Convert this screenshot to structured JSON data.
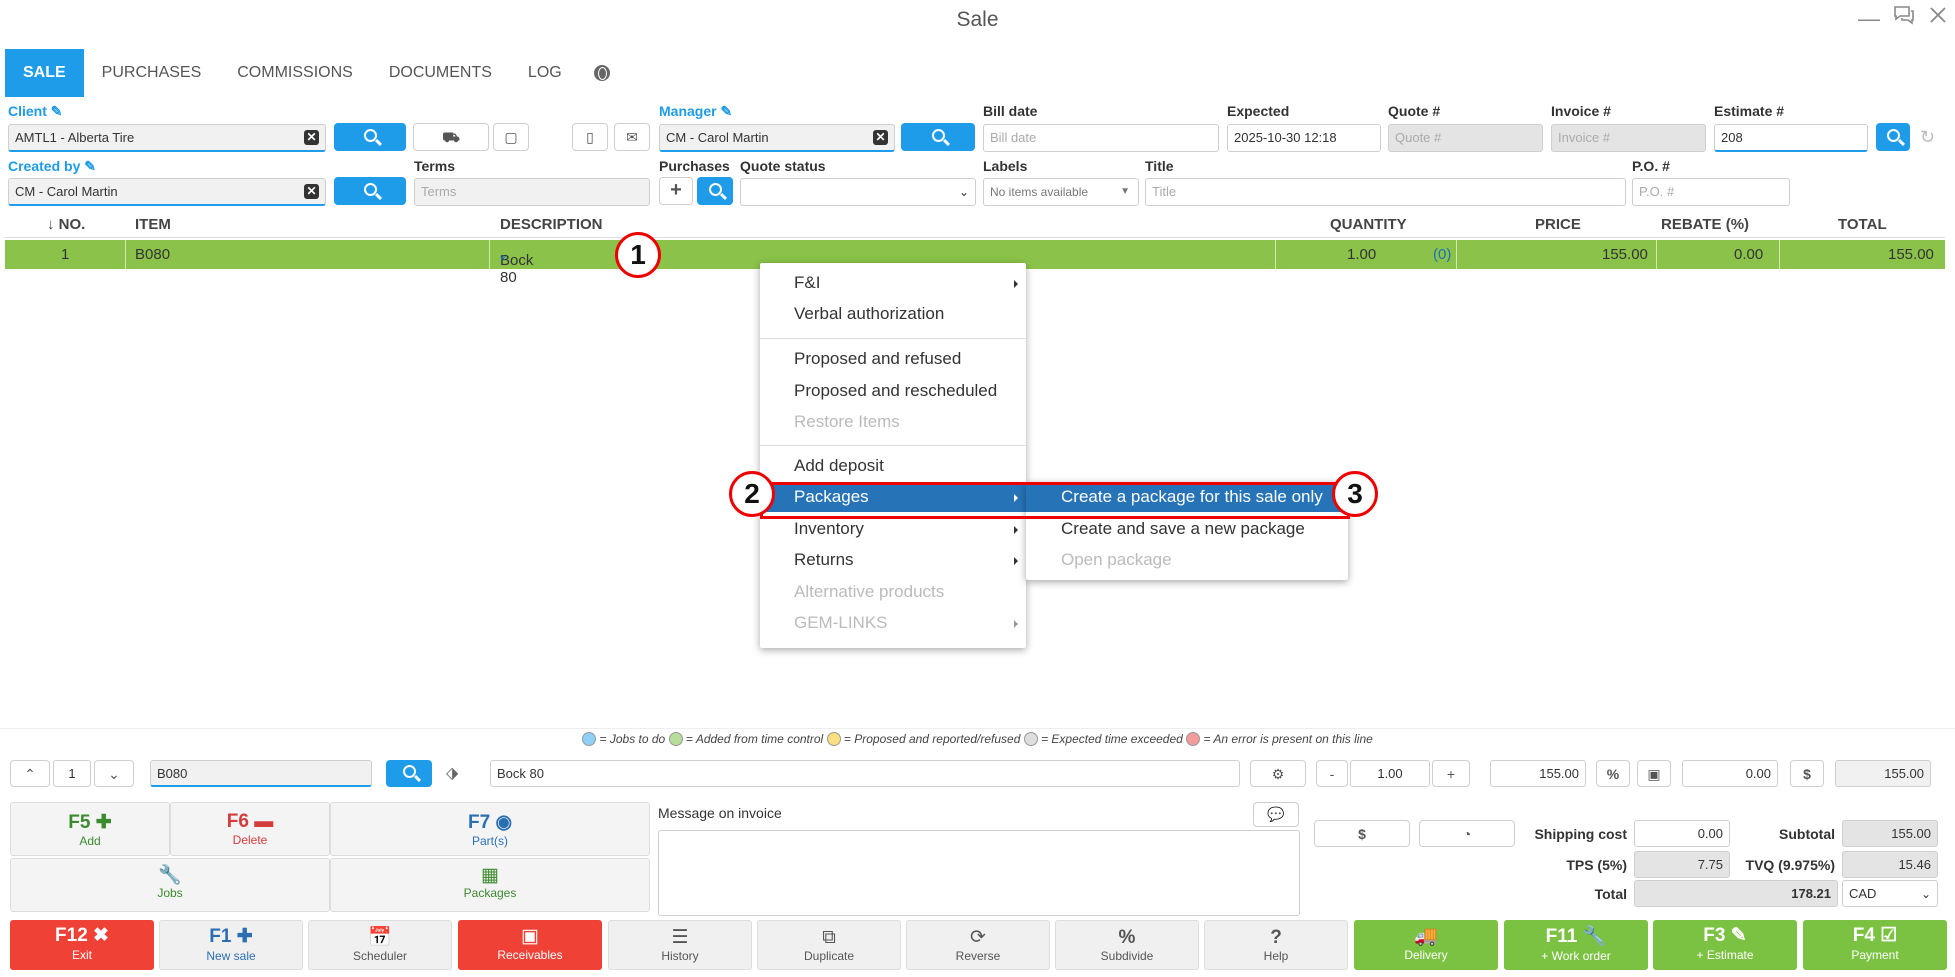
{
  "window": {
    "title": "Sale"
  },
  "tabs": [
    {
      "label": "SALE"
    },
    {
      "label": "PURCHASES"
    },
    {
      "label": "COMMISSIONS"
    },
    {
      "label": "DOCUMENTS"
    },
    {
      "label": "LOG"
    }
  ],
  "form": {
    "client_label": "Client",
    "client_value": "AMTL1 - Alberta Tire",
    "manager_label": "Manager",
    "manager_value": "CM - Carol Martin",
    "bill_date_label": "Bill date",
    "bill_date_placeholder": "Bill date",
    "expected_label": "Expected",
    "expected_value": "2025-10-30 12:18",
    "quote_label": "Quote #",
    "quote_placeholder": "Quote #",
    "invoice_label": "Invoice #",
    "invoice_placeholder": "Invoice #",
    "estimate_label": "Estimate #",
    "estimate_value": "208",
    "created_by_label": "Created by",
    "created_by_value": "CM - Carol Martin",
    "terms_label": "Terms",
    "terms_placeholder": "Terms",
    "purchases_label": "Purchases",
    "quote_status_label": "Quote status",
    "labels_label": "Labels",
    "labels_value": "No items available",
    "title_label": "Title",
    "title_placeholder": "Title",
    "po_label": "P.O. #",
    "po_placeholder": "P.O. #"
  },
  "grid": {
    "headers": [
      "↓ NO.",
      "ITEM",
      "DESCRIPTION",
      "QUANTITY",
      "PRICE",
      "REBATE (%)",
      "TOTAL"
    ],
    "rows": [
      {
        "no": "1",
        "item": "B080",
        "description": "Bock 80",
        "star": "*",
        "quantity": "1.00",
        "reserved": "(0)",
        "price": "155.00",
        "rebate": "0.00",
        "total": "155.00"
      }
    ]
  },
  "callouts": [
    "1",
    "2",
    "3"
  ],
  "context_menu": {
    "items": [
      {
        "label": "F&I"
      },
      {
        "label": "Verbal authorization"
      },
      {
        "label": "Proposed and refused"
      },
      {
        "label": "Proposed and rescheduled"
      },
      {
        "label": "Restore Items"
      },
      {
        "label": "Add deposit"
      },
      {
        "label": "Packages"
      },
      {
        "label": "Inventory"
      },
      {
        "label": "Returns"
      },
      {
        "label": "Alternative products"
      },
      {
        "label": "GEM-LINKS"
      }
    ],
    "submenu": [
      {
        "label": "Create a package for this sale only"
      },
      {
        "label": "Create and save a new package"
      },
      {
        "label": "Open package"
      }
    ]
  },
  "legend": {
    "jobs": "= Jobs to do",
    "added": "= Added from time control",
    "proposed": "= Proposed and reported/refused",
    "exceeded": "= Expected time exceeded",
    "error": "= An error is present on this line"
  },
  "colors": {
    "blue": "#1e9be9",
    "green_row": "#8bc34a",
    "menu_highlight": "#2673b8",
    "callout_red": "#ee0000",
    "red_button": "#ef4136",
    "green_button": "#7cc242"
  },
  "editor": {
    "line_no": "1",
    "item": "B080",
    "description": "Bock 80",
    "minus": "-",
    "quantity": "1.00",
    "plus": "+",
    "price": "155.00",
    "pct": "%",
    "rebate": "0.00",
    "dollar": "$",
    "total": "155.00"
  },
  "actions": {
    "f5_key": "F5",
    "f5_sub": "Add",
    "f6_key": "F6",
    "f6_sub": "Delete",
    "f7_key": "F7",
    "f7_sub": "Part(s)",
    "jobs": "Jobs",
    "packages": "Packages"
  },
  "message": {
    "label": "Message on invoice"
  },
  "summary": {
    "dollar": "$",
    "shipping_label": "Shipping cost",
    "shipping": "0.00",
    "subtotal_label": "Subtotal",
    "subtotal": "155.00",
    "tps_label": "TPS (5%)",
    "tps": "7.75",
    "tvq_label": "TVQ (9.975%)",
    "tvq": "15.46",
    "total_label": "Total",
    "total": "178.21",
    "currency": "CAD"
  },
  "bottom": {
    "exit_key": "F12",
    "exit": "Exit",
    "new_key": "F1",
    "new": "New sale",
    "scheduler": "Scheduler",
    "receivables": "Receivables",
    "history": "History",
    "duplicate": "Duplicate",
    "reverse": "Reverse",
    "subdivide": "Subdivide",
    "help": "Help",
    "delivery": "Delivery",
    "wo_key": "F11",
    "wo": "+ Work order",
    "est_key": "F3",
    "est": "+ Estimate",
    "pay_key": "F4",
    "pay": "Payment"
  }
}
